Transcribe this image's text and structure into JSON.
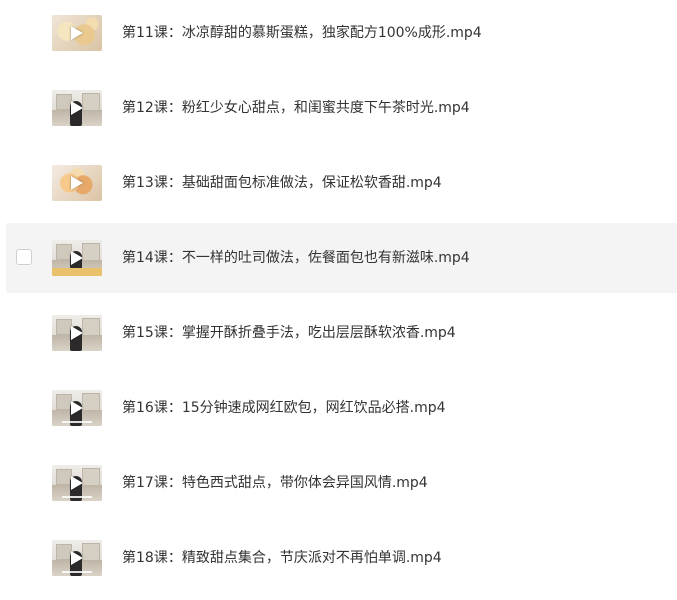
{
  "files": [
    {
      "name": "第11课：冰凉醇甜的慕斯蛋糕，独家配方100%成形.mp4",
      "thumbnail": "food-thumbnail",
      "hovered": false
    },
    {
      "name": "第12课：粉红少女心甜点，和闺蜜共度下午茶时光.mp4",
      "thumbnail": "kitchen-thumbnail",
      "hovered": false
    },
    {
      "name": "第13课：基础甜面包标准做法，保证松软香甜.mp4",
      "thumbnail": "food-thumbnail",
      "hovered": false
    },
    {
      "name": "第14课：不一样的吐司做法，佐餐面包也有新滋味.mp4",
      "thumbnail": "kitchen-thumbnail",
      "hovered": true
    },
    {
      "name": "第15课：掌握开酥折叠手法，吃出层层酥软浓香.mp4",
      "thumbnail": "kitchen-thumbnail",
      "hovered": false
    },
    {
      "name": "第16课：15分钟速成网红欧包，网红饮品必搭.mp4",
      "thumbnail": "kitchen-thumbnail",
      "hovered": false
    },
    {
      "name": "第17课：特色西式甜点，带你体会异国风情.mp4",
      "thumbnail": "kitchen-thumbnail",
      "hovered": false
    },
    {
      "name": "第18课：精致甜点集合，节庆派对不再怕单调.mp4",
      "thumbnail": "kitchen-thumbnail",
      "hovered": false
    }
  ],
  "colors": {
    "row_hover_background": "#f4f4f5",
    "text": "#333333",
    "checkbox_border": "#cfcfcf"
  },
  "icons": {
    "play": "play-icon",
    "checkbox": "checkbox"
  }
}
